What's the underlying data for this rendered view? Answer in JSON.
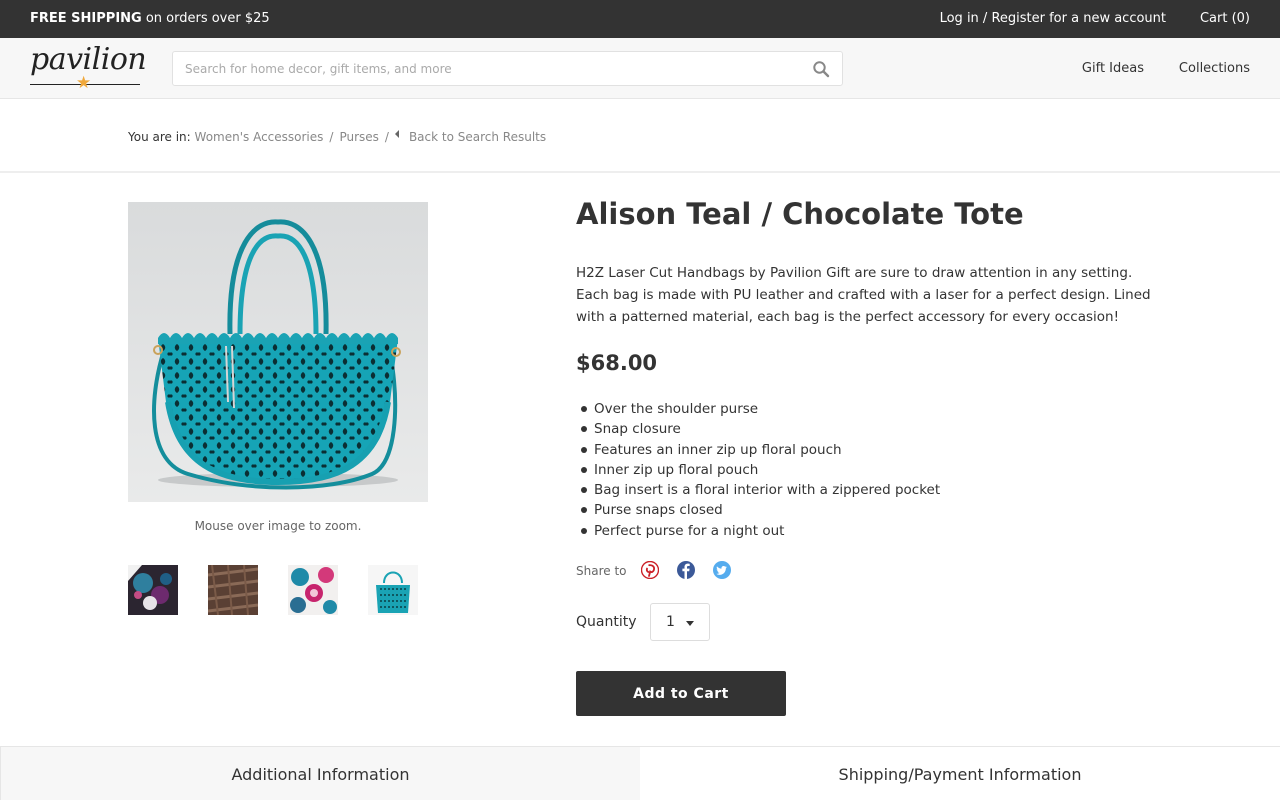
{
  "topbar": {
    "promo_bold": "FREE SHIPPING",
    "promo_rest": " on orders over $25",
    "login": "Log in / Register for a new account",
    "cart": "Cart (0)"
  },
  "header": {
    "logo_text": "pavilion",
    "search_placeholder": "Search for home decor, gift items, and more",
    "nav": [
      "Gift Ideas",
      "Collections"
    ]
  },
  "breadcrumb": {
    "prefix": "You are in:",
    "items": [
      "Women's Accessories",
      "Purses"
    ],
    "separator": "/",
    "back": "Back to Search Results"
  },
  "product": {
    "title": "Alison Teal / Chocolate Tote",
    "description": "H2Z Laser Cut Handbags by Pavilion Gift are sure to draw attention in any setting. Each bag is made with PU leather and crafted with a laser for a perfect design. Lined with a patterned material, each bag is the perfect accessory for every occasion!",
    "price": "$68.00",
    "features": [
      "Over the shoulder purse",
      "Snap closure",
      "Features an inner zip up floral pouch",
      "Inner zip up floral pouch",
      "Bag insert is a floral interior with a zippered pocket",
      "Purse snaps closed",
      "Perfect purse for a night out"
    ],
    "zoom_hint": "Mouse over image to zoom.",
    "share_label": "Share to",
    "quantity_label": "Quantity",
    "quantity_value": "1",
    "add_to_cart": "Add to Cart"
  },
  "tabs": [
    "Additional Information",
    "Shipping/Payment Information"
  ],
  "colors": {
    "topbar_bg": "#333333",
    "bag_teal": "#1aa3b4",
    "pinterest": "#cb2027",
    "facebook": "#3b5998",
    "twitter": "#55acee",
    "logo_star": "#f0a83b"
  },
  "icons": [
    "search-icon",
    "back-arrow-icon",
    "pinterest-icon",
    "facebook-icon",
    "twitter-icon",
    "chevron-down-icon"
  ]
}
